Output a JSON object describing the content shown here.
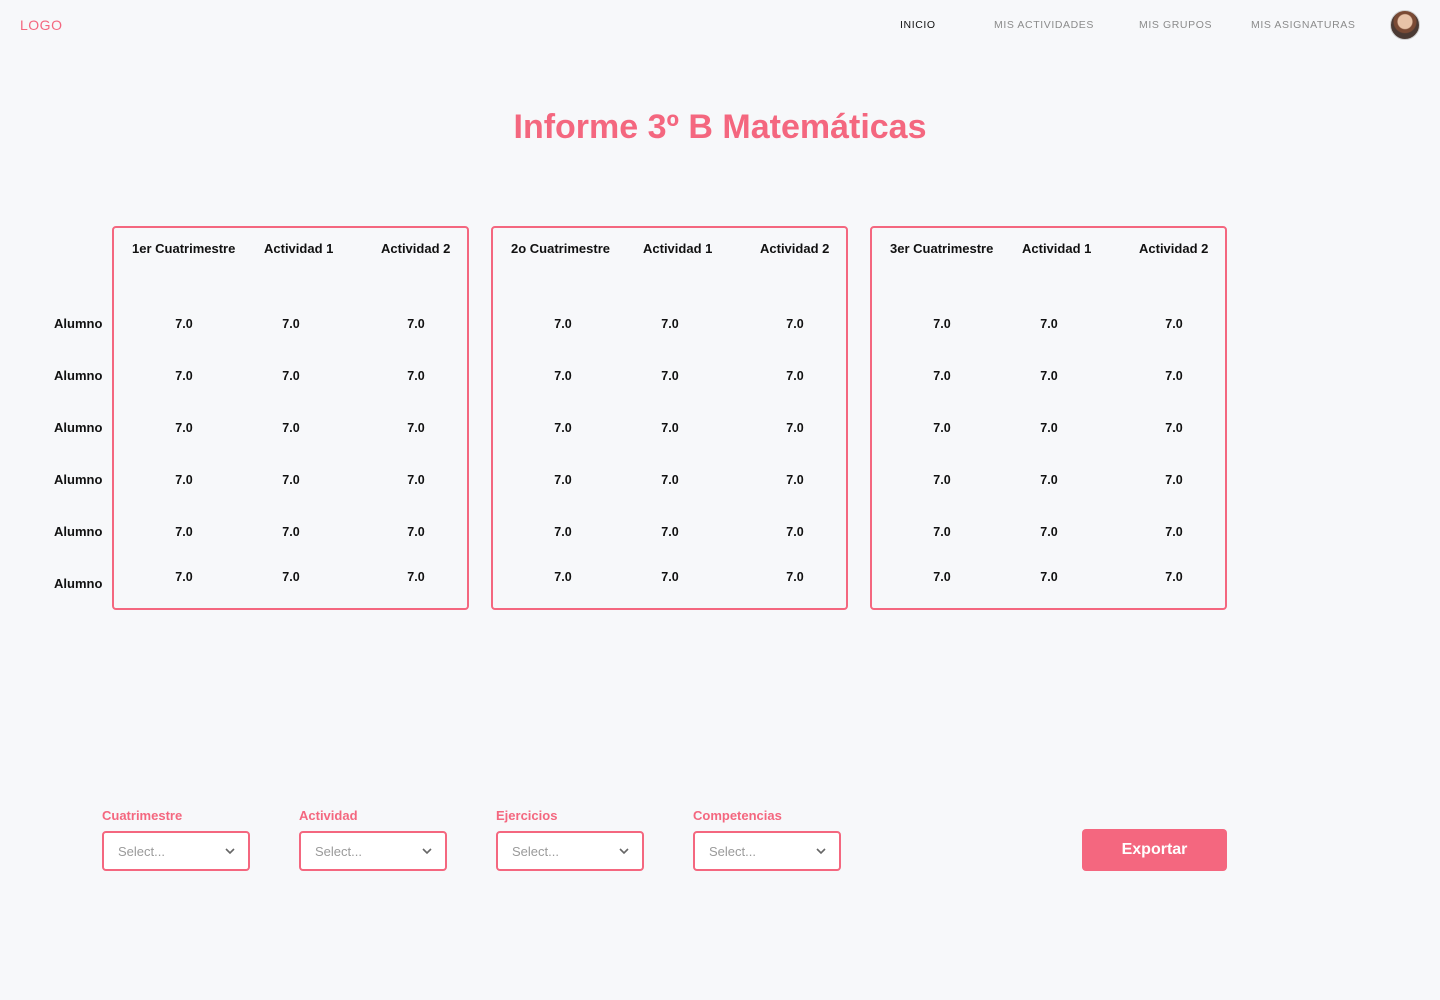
{
  "header": {
    "logo": "LOGO",
    "nav": [
      {
        "label": "INICIO",
        "active": true
      },
      {
        "label": "MIS ACTIVIDADES",
        "active": false
      },
      {
        "label": "MIS GRUPOS",
        "active": false
      },
      {
        "label": "MIS ASIGNATURAS",
        "active": false
      }
    ],
    "avatar_icon": "user-avatar"
  },
  "page_title": "Informe 3º B Matemáticas",
  "row_labels": [
    "Alumno",
    "Alumno",
    "Alumno",
    "Alumno",
    "Alumno",
    "Alumno"
  ],
  "panels": [
    {
      "headers": [
        "1er Cuatrimestre",
        "Actividad 1",
        "Actividad 2"
      ],
      "rows": [
        [
          "7.0",
          "7.0",
          "7.0"
        ],
        [
          "7.0",
          "7.0",
          "7.0"
        ],
        [
          "7.0",
          "7.0",
          "7.0"
        ],
        [
          "7.0",
          "7.0",
          "7.0"
        ],
        [
          "7.0",
          "7.0",
          "7.0"
        ],
        [
          "7.0",
          "7.0",
          "7.0"
        ]
      ]
    },
    {
      "headers": [
        "2o Cuatrimestre",
        "Actividad 1",
        "Actividad 2"
      ],
      "rows": [
        [
          "7.0",
          "7.0",
          "7.0"
        ],
        [
          "7.0",
          "7.0",
          "7.0"
        ],
        [
          "7.0",
          "7.0",
          "7.0"
        ],
        [
          "7.0",
          "7.0",
          "7.0"
        ],
        [
          "7.0",
          "7.0",
          "7.0"
        ],
        [
          "7.0",
          "7.0",
          "7.0"
        ]
      ]
    },
    {
      "headers": [
        "3er Cuatrimestre",
        "Actividad 1",
        "Actividad 2"
      ],
      "rows": [
        [
          "7.0",
          "7.0",
          "7.0"
        ],
        [
          "7.0",
          "7.0",
          "7.0"
        ],
        [
          "7.0",
          "7.0",
          "7.0"
        ],
        [
          "7.0",
          "7.0",
          "7.0"
        ],
        [
          "7.0",
          "7.0",
          "7.0"
        ],
        [
          "7.0",
          "7.0",
          "7.0"
        ]
      ]
    }
  ],
  "filters": [
    {
      "label": "Cuatrimestre",
      "placeholder": "Select..."
    },
    {
      "label": "Actividad",
      "placeholder": "Select..."
    },
    {
      "label": "Ejercicios",
      "placeholder": "Select..."
    },
    {
      "label": "Competencias",
      "placeholder": "Select..."
    }
  ],
  "export_label": "Exportar",
  "colors": {
    "accent": "#f4677f",
    "background": "#f7f8fa"
  }
}
